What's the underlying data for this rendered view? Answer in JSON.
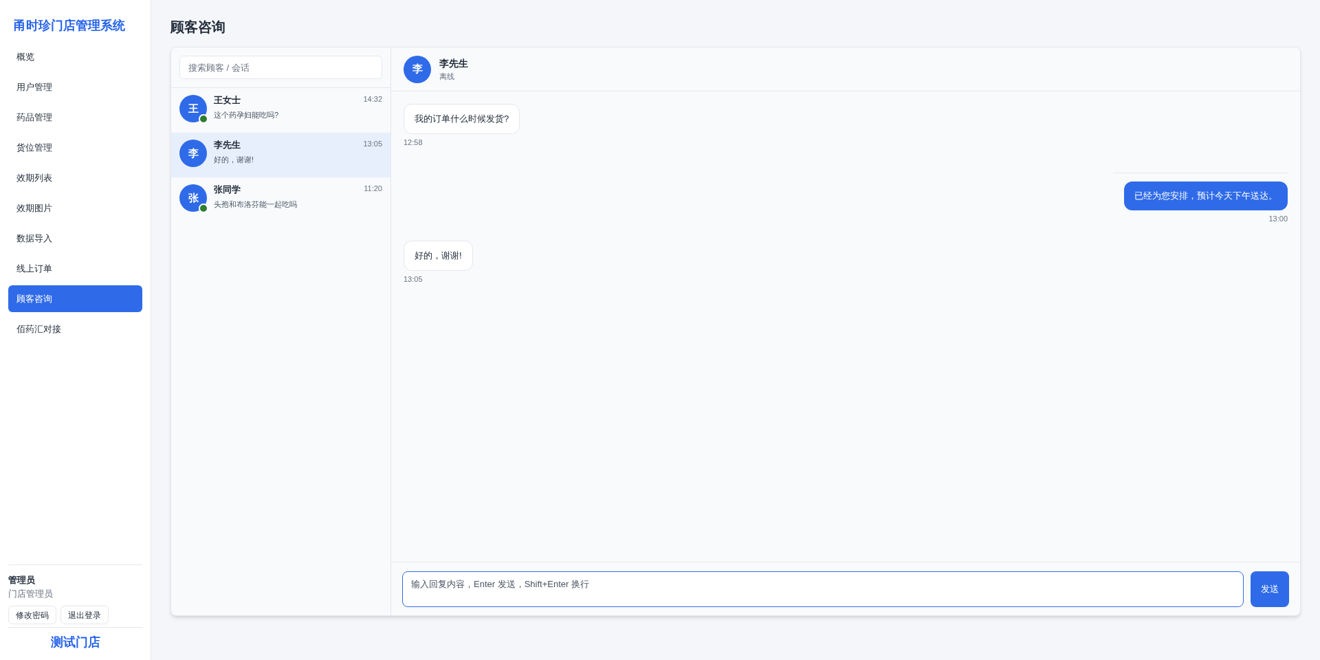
{
  "sidebar": {
    "title": "甬时珍门店管理系统",
    "items": [
      {
        "label": "概览",
        "selected": false
      },
      {
        "label": "用户管理",
        "selected": false
      },
      {
        "label": "药品管理",
        "selected": false
      },
      {
        "label": "货位管理",
        "selected": false
      },
      {
        "label": "效期列表",
        "selected": false
      },
      {
        "label": "效期图片",
        "selected": false
      },
      {
        "label": "数据导入",
        "selected": false
      },
      {
        "label": "线上订单",
        "selected": false
      },
      {
        "label": "顾客咨询",
        "selected": true
      },
      {
        "label": "佰药汇对接",
        "selected": false
      }
    ],
    "user": {
      "name": "管理员",
      "role": "门店管理员",
      "buttons": [
        "修改密码",
        "退出登录"
      ]
    },
    "store": "测试门店"
  },
  "page_title": "顾客咨询",
  "conversations": {
    "search": {
      "placeholder": "搜索顾客 / 会话"
    },
    "items": [
      {
        "avatar": "王",
        "name": "王女士",
        "time": "14:32",
        "preview": "这个药孕妇能吃吗?",
        "online": true,
        "selected": false
      },
      {
        "avatar": "李",
        "name": "李先生",
        "time": "13:05",
        "preview": "好的，谢谢!",
        "online": false,
        "selected": true
      },
      {
        "avatar": "张",
        "name": "张同学",
        "time": "11:20",
        "preview": "头孢和布洛芬能一起吃吗",
        "online": true,
        "selected": false
      }
    ]
  },
  "chat": {
    "avatar": "李",
    "name": "李先生",
    "status": "离线",
    "messages": [
      {
        "kind": "incoming",
        "text": "我的订单什么时候发货?",
        "time": "12:58"
      },
      {
        "kind": "outgoing",
        "text": "已经为您安排，预计今天下午送达。",
        "time": "13:00"
      },
      {
        "kind": "incoming",
        "text": "好的，谢谢!",
        "time": "13:05"
      }
    ],
    "input": {
      "placeholder": "输入回复内容，Enter 发送，Shift+Enter 换行"
    },
    "send_button": "发送"
  }
}
